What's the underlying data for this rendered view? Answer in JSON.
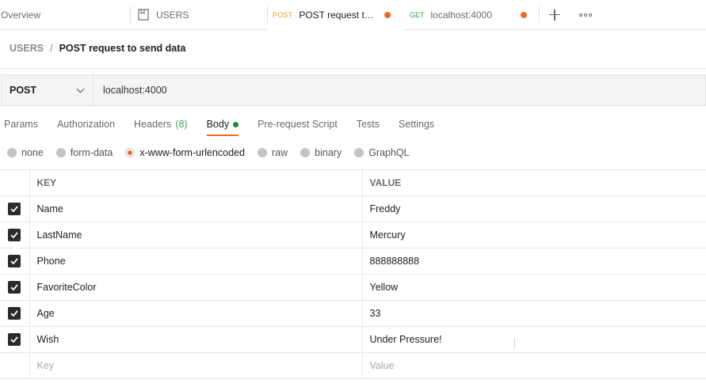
{
  "tabs": [
    {
      "label": "Overview"
    },
    {
      "label": "USERS"
    },
    {
      "method": "POST",
      "label": "POST request to ..."
    },
    {
      "method": "GET",
      "label": "localhost:4000"
    }
  ],
  "breadcrumb": {
    "root": "USERS",
    "separator": "/",
    "current": "POST request to send data"
  },
  "request": {
    "method": "POST",
    "url": "localhost:4000"
  },
  "request_tabs": {
    "params": "Params",
    "authorization": "Authorization",
    "headers": "Headers",
    "headers_count": "(8)",
    "body": "Body",
    "prerequest": "Pre-request Script",
    "tests": "Tests",
    "settings": "Settings"
  },
  "body_types": [
    "none",
    "form-data",
    "x-www-form-urlencoded",
    "raw",
    "binary",
    "GraphQL"
  ],
  "table": {
    "headers": {
      "key": "KEY",
      "value": "VALUE"
    },
    "rows": [
      {
        "key": "Name",
        "value": "Freddy"
      },
      {
        "key": "LastName",
        "value": "Mercury"
      },
      {
        "key": "Phone",
        "value": "888888888"
      },
      {
        "key": "FavoriteColor",
        "value": "Yellow"
      },
      {
        "key": "Age",
        "value": "33"
      },
      {
        "key": "Wish",
        "value": "Under Pressure!"
      }
    ],
    "placeholder": {
      "key": "Key",
      "value": "Value"
    }
  },
  "colors": {
    "accent": "#f26b21",
    "post": "#e5a23b",
    "get": "#3fa35b",
    "success": "#168a3a"
  }
}
